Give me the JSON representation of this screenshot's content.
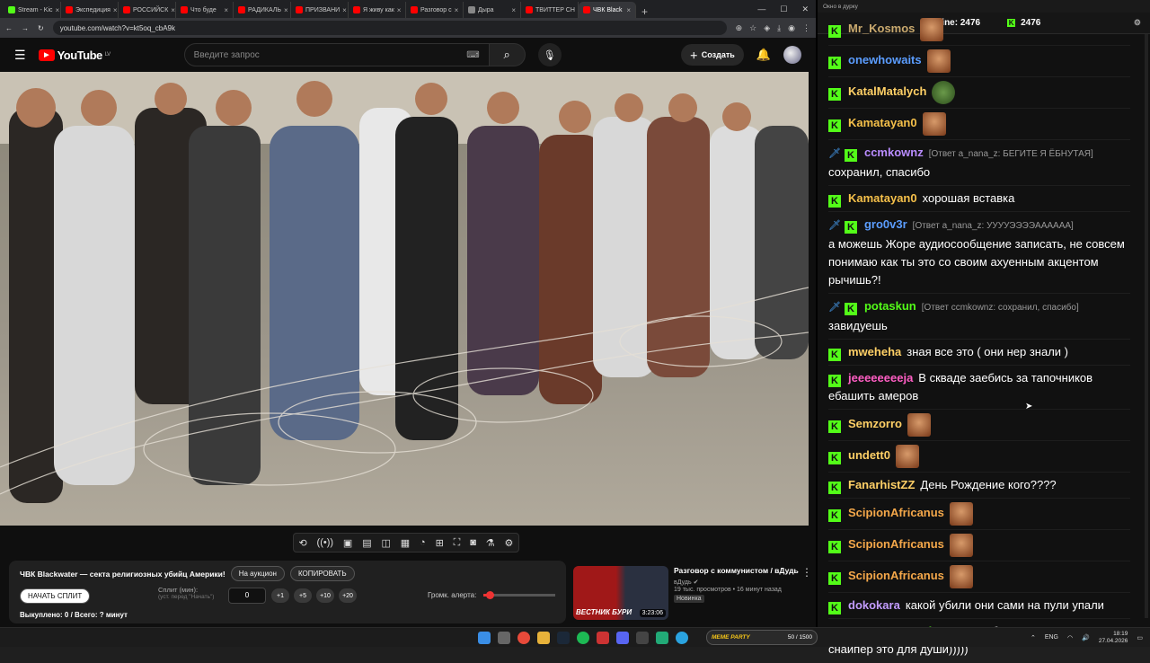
{
  "browser": {
    "tabs": [
      {
        "title": "Stream - Kic",
        "color": "#53fc18"
      },
      {
        "title": "Экспедиция",
        "color": "#ff0000"
      },
      {
        "title": "РОССИЙСК",
        "color": "#ff0000"
      },
      {
        "title": "Что буде",
        "color": "#ff0000"
      },
      {
        "title": "РАДИКАЛЬ",
        "color": "#ff0000"
      },
      {
        "title": "ПРИЗВАНИ",
        "color": "#ff0000"
      },
      {
        "title": "Я живу как",
        "color": "#ff0000"
      },
      {
        "title": "Разговор с",
        "color": "#ff0000"
      },
      {
        "title": "Дыра",
        "color": "#888888"
      },
      {
        "title": "ТВИТТЕР СН",
        "color": "#ff0000"
      },
      {
        "title": "ЧВК Black",
        "color": "#ff0000",
        "active": true
      }
    ],
    "new_tab": "+",
    "url": "youtube.com/watch?v=kt5oq_cbA9k",
    "ext_badges": {
      "red": "2",
      "count": "214"
    }
  },
  "youtube": {
    "logo": "YouTube",
    "region": "LV",
    "search_placeholder": "Введите запрос",
    "create_label": "Создать"
  },
  "info": {
    "video_title": "ЧВК Blackwater — секта религиозных убийц Америки!",
    "auction_btn": "На аукцион",
    "copy_btn": "КОПИРОВАТЬ",
    "start_split_btn": "НАЧАТЬ СПЛИТ",
    "split_label": "Сплит (мин):",
    "split_hint": "(уст. перед \"Начать\")",
    "split_value": "0",
    "plus_buttons": [
      "+1",
      "+5",
      "+10",
      "+20"
    ],
    "alert_volume_label": "Громк. алерта:",
    "alert_volume": 0.08,
    "bought_text": "Выкуплено: 0 / Всего: ? минут"
  },
  "recommended": {
    "title": "Разговор с коммунистом / вДудь",
    "channel": "вДудь",
    "meta": "19 тыс. просмотров • 16 минут назад",
    "badge": "Новинка",
    "thumb_caption": "ВЕСТНИК БУРИ",
    "duration": "3:23:06"
  },
  "chat": {
    "window_title": "Окно в дурку",
    "online_label": "Online:",
    "online_count": "2476",
    "kick_count": "2476",
    "messages": [
      {
        "user": "Mr_Kosmos",
        "color": "#c9a96e",
        "text": "",
        "reply": "",
        "emote": true
      },
      {
        "user": "onewhowaits",
        "color": "#5b9dff",
        "text": "",
        "reply": "",
        "emote": true
      },
      {
        "user": "KatalMatalych",
        "color": "#ffd066",
        "text": "",
        "reply": "",
        "emote": true
      },
      {
        "user": "Kamatayan0",
        "color": "#f5c04a",
        "text": "",
        "reply": "",
        "emote": true
      },
      {
        "user": "ccmkownz",
        "color": "#b98cff",
        "text": "сохранил, спасибо",
        "reply": "[Ответ a_nana_z: БЕГИТЕ Я ЁБНУТАЯ]",
        "emote": false
      },
      {
        "user": "Kamatayan0",
        "color": "#f5c04a",
        "text": "хорошая вставка",
        "reply": "",
        "emote": false
      },
      {
        "user": "gro0v3r",
        "color": "#5b9dff",
        "text": "а можешь Жоре аудиосообщение записать, не совсем понимаю как ты это со своим ахуенным акцентом рычишь?!",
        "reply": "[Ответ a_nana_z: УУУУЭЭЭЭАААААА]",
        "emote": false
      },
      {
        "user": "potaskun",
        "color": "#53fc18",
        "text": "завидуешь",
        "reply": "[Ответ ccmkownz: сохранил, спасибо]",
        "emote": false
      },
      {
        "user": "mweheha",
        "color": "#ffd066",
        "text": "зная все это ( они нер знали )",
        "reply": "",
        "emote": false
      },
      {
        "user": "jeeeeeeeeja",
        "color": "#ff5ec4",
        "text": "В скваде заебись за тапочников ебашить амеров",
        "reply": "",
        "emote": false
      },
      {
        "user": "Semzorro",
        "color": "#ffd066",
        "text": "",
        "reply": "",
        "emote": true
      },
      {
        "user": "undett0",
        "color": "#ffd066",
        "text": "",
        "reply": "",
        "emote": true
      },
      {
        "user": "FanarhistZZ",
        "color": "#ffd066",
        "text": "День Рождение кого????",
        "reply": "",
        "emote": false
      },
      {
        "user": "ScipionAfricanus",
        "color": "#f5a84a",
        "text": "",
        "reply": "",
        "emote": true
      },
      {
        "user": "ScipionAfricanus",
        "color": "#f5a84a",
        "text": "",
        "reply": "",
        "emote": true
      },
      {
        "user": "ScipionAfricanus",
        "color": "#f5a84a",
        "text": "",
        "reply": "",
        "emote": true
      },
      {
        "user": "dokokara",
        "color": "#c39cff",
        "text": "какой убили они сами на пули упали",
        "reply": "",
        "emote": false
      },
      {
        "user": "GYDI_PO_Rusky",
        "color": "#53fc18",
        "text": "так то я булками торгую, а снайпер это для души)))))",
        "reply": "",
        "emote": false
      }
    ]
  },
  "taskbar": {
    "meme_party": "MEME PARTY",
    "meme_count": "50 / 1500",
    "lang": "ENG",
    "time": "18:19",
    "date": "27.04.2026"
  },
  "colors": {
    "kick_green": "#53fc18",
    "yt_red": "#ff0000"
  }
}
